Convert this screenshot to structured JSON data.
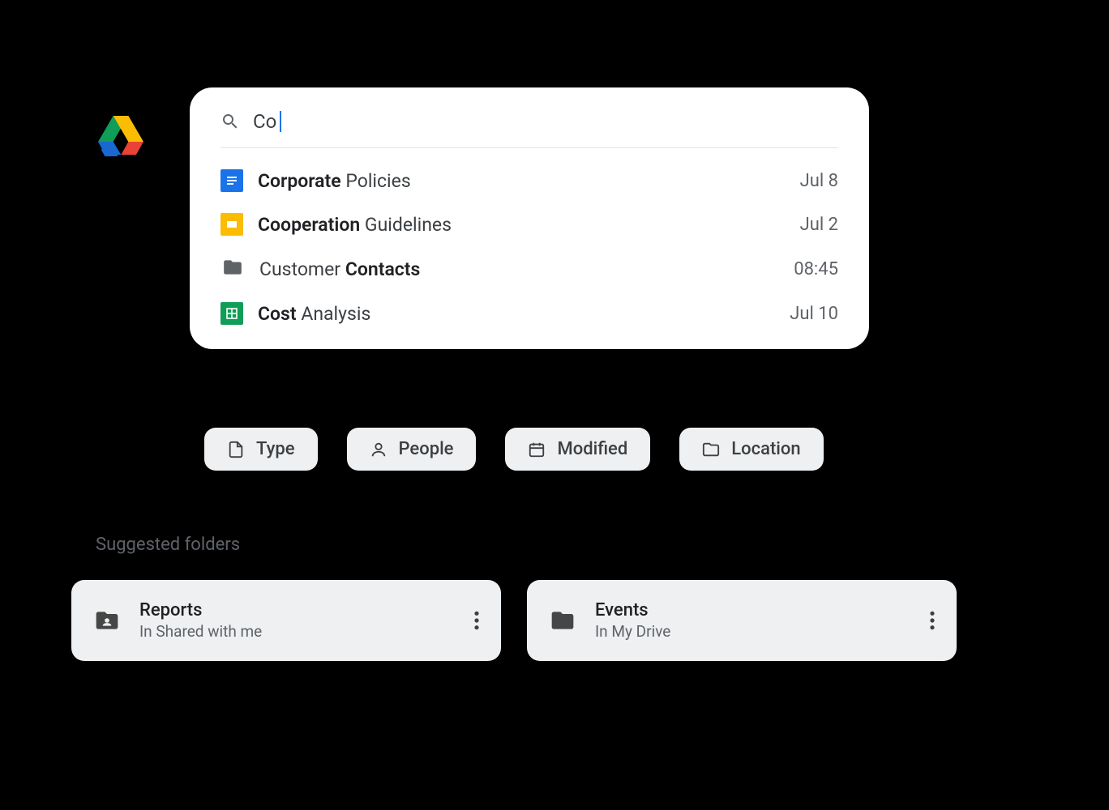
{
  "search": {
    "query": "Co"
  },
  "results": [
    {
      "type": "doc",
      "title_bold": "Corporate",
      "title_rest": " Policies",
      "date": "Jul 8"
    },
    {
      "type": "slides",
      "title_bold": "Cooperation",
      "title_rest": " Guidelines",
      "date": "Jul 2"
    },
    {
      "type": "folder",
      "title_pre": "Customer ",
      "title_bold": "Contacts",
      "date": "08:45"
    },
    {
      "type": "sheets",
      "title_bold": "Cost",
      "title_rest": " Analysis",
      "date": "Jul 10"
    }
  ],
  "chips": {
    "type": "Type",
    "people": "People",
    "modified": "Modified",
    "location": "Location"
  },
  "suggested_label": "Suggested folders",
  "folders": [
    {
      "name": "Reports",
      "location": "In Shared with me",
      "icon": "shared"
    },
    {
      "name": "Events",
      "location": "In My Drive",
      "icon": "folder"
    }
  ]
}
